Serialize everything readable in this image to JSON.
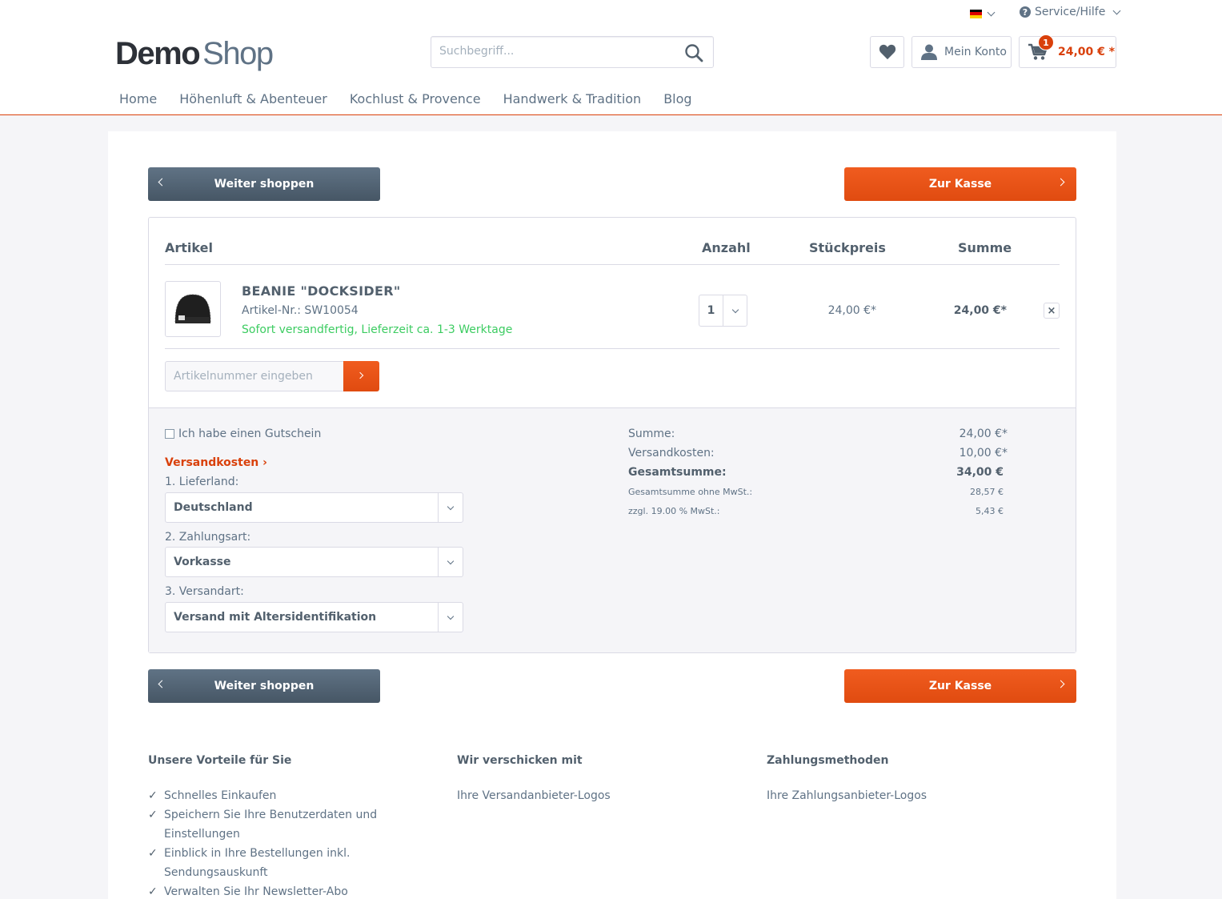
{
  "header": {
    "logo_bold": "Demo",
    "logo_light": "Shop",
    "service": "Service/Hilfe",
    "search_placeholder": "Suchbegriff...",
    "account": "Mein Konto",
    "cart_count": "1",
    "cart_total": "24,00 € *"
  },
  "nav": [
    "Home",
    "Höhenluft & Abenteuer",
    "Kochlust & Provence",
    "Handwerk & Tradition",
    "Blog"
  ],
  "buttons": {
    "continue": "Weiter shoppen",
    "checkout": "Zur Kasse"
  },
  "table": {
    "headers": {
      "article": "Artikel",
      "qty": "Anzahl",
      "unit": "Stückpreis",
      "total": "Summe"
    }
  },
  "item": {
    "name": "BEANIE \"DOCKSIDER\"",
    "sku": "Artikel-Nr.: SW10054",
    "delivery": "Sofort versandfertig, Lieferzeit ca. 1-3 Werktage",
    "qty": "1",
    "unit_price": "24,00 €*",
    "total": "24,00 €*",
    "remove": "×"
  },
  "add_article": {
    "placeholder": "Artikelnummer eingeben"
  },
  "aggregation": {
    "voucher": "Ich habe einen Gutschein",
    "shipping_link": "Versandkosten ›",
    "country_label": "1. Lieferland:",
    "country": "Deutschland",
    "payment_label": "2. Zahlungsart:",
    "payment": "Vorkasse",
    "dispatch_label": "3. Versandart:",
    "dispatch": "Versand mit Altersidentifikation",
    "rows": [
      {
        "label": "Summe:",
        "value": "24,00 €*"
      },
      {
        "label": "Versandkosten:",
        "value": "10,00 €*"
      },
      {
        "label": "Gesamtsumme:",
        "value": "34,00 €"
      },
      {
        "label": "Gesamtsumme ohne MwSt.:",
        "value": "28,57 €"
      },
      {
        "label": "zzgl. 19.00 % MwSt.:",
        "value": "5,43 €"
      }
    ]
  },
  "footer": {
    "col1_title": "Unsere Vorteile für Sie",
    "col1_items": [
      "Schnelles Einkaufen",
      "Speichern Sie Ihre Benutzerdaten und Einstellungen",
      "Einblick in Ihre Bestellungen inkl. Sendungsauskunft",
      "Verwalten Sie Ihr Newsletter-Abo"
    ],
    "col2_title": "Wir verschicken mit",
    "col2_text": "Ihre Versandanbieter-Logos",
    "col3_title": "Zahlungsmethoden",
    "col3_text": "Ihre Zahlungsanbieter-Logos"
  }
}
